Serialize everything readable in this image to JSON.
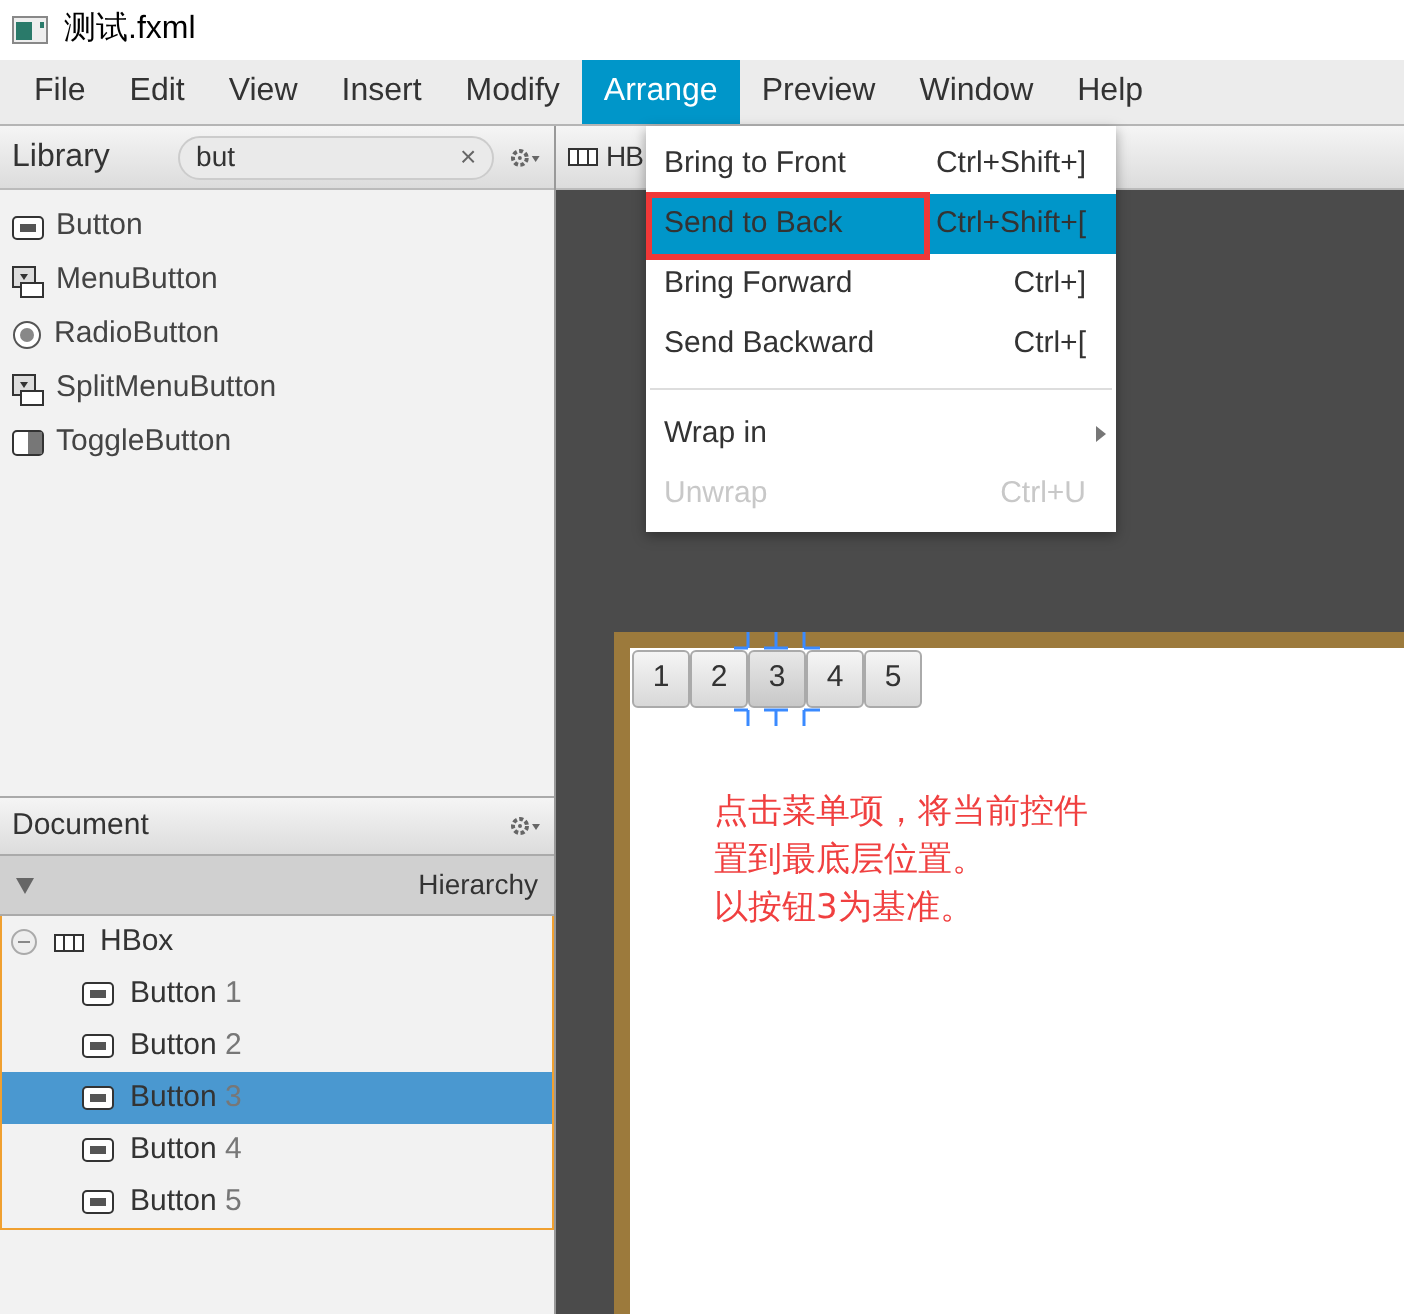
{
  "window": {
    "title": "测试.fxml"
  },
  "menu_bar": [
    {
      "label": "File",
      "selected": false
    },
    {
      "label": "Edit",
      "selected": false
    },
    {
      "label": "View",
      "selected": false
    },
    {
      "label": "Insert",
      "selected": false
    },
    {
      "label": "Modify",
      "selected": false
    },
    {
      "label": "Arrange",
      "selected": true
    },
    {
      "label": "Preview",
      "selected": false
    },
    {
      "label": "Window",
      "selected": false
    },
    {
      "label": "Help",
      "selected": false
    }
  ],
  "menu": {
    "items": [
      {
        "kind": "item",
        "label": "Bring to Front",
        "shortcut": "Ctrl+Shift+]",
        "selected": false,
        "disabled": false,
        "annotated": false
      },
      {
        "kind": "item",
        "label": "Send to Back",
        "shortcut": "Ctrl+Shift+[",
        "selected": true,
        "disabled": false,
        "annotated": true
      },
      {
        "kind": "item",
        "label": "Bring Forward",
        "shortcut": "Ctrl+]",
        "selected": false,
        "disabled": false,
        "annotated": false
      },
      {
        "kind": "item",
        "label": "Send Backward",
        "shortcut": "Ctrl+[",
        "selected": false,
        "disabled": false,
        "annotated": false
      },
      {
        "kind": "separator"
      },
      {
        "kind": "submenu",
        "label": "Wrap in",
        "selected": false,
        "disabled": false,
        "annotated": false
      },
      {
        "kind": "item",
        "label": "Unwrap",
        "shortcut": "Ctrl+U",
        "selected": false,
        "disabled": true,
        "annotated": false
      }
    ]
  },
  "library": {
    "title": "Library",
    "search": {
      "value": "but",
      "clear": "×"
    },
    "items": [
      {
        "kind": "button",
        "label": "Button"
      },
      {
        "kind": "menu",
        "label": "MenuButton"
      },
      {
        "kind": "radio",
        "label": "RadioButton"
      },
      {
        "kind": "menu",
        "label": "SplitMenuButton"
      },
      {
        "kind": "toggle",
        "label": "ToggleButton"
      }
    ]
  },
  "document": {
    "title": "Document",
    "column": "Hierarchy",
    "tree": [
      {
        "label": "HBox",
        "expanded": true,
        "children": [
          {
            "label": "Button",
            "number": "1",
            "selected": false
          },
          {
            "label": "Button",
            "number": "2",
            "selected": false
          },
          {
            "label": "Button",
            "number": "3",
            "selected": true
          },
          {
            "label": "Button",
            "number": "4",
            "selected": false
          },
          {
            "label": "Button",
            "number": "5",
            "selected": false
          }
        ]
      }
    ]
  },
  "canvas": {
    "tab": "HB",
    "buttons": [
      {
        "label": "1",
        "selected": false
      },
      {
        "label": "2",
        "selected": false
      },
      {
        "label": "3",
        "selected": true
      },
      {
        "label": "4",
        "selected": false
      },
      {
        "label": "5",
        "selected": false
      }
    ],
    "note": [
      "点击菜单项，将当前控件",
      "置到最底层位置。",
      "以按钮3为基准。"
    ]
  }
}
